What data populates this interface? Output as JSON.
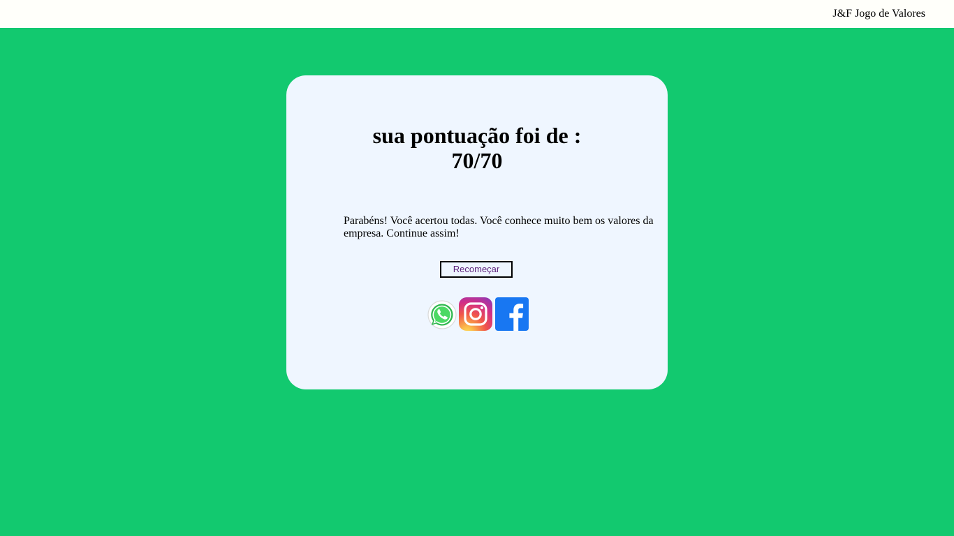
{
  "header": {
    "brand": "J&F Jogo de Valores"
  },
  "result": {
    "title_line1": "sua pontuação foi de :",
    "score": "70/70",
    "message": "Parabéns! Você acertou todas. Você conhece muito bem os valores da empresa. Continue assim!",
    "restart_label": "Recomeçar"
  },
  "social": {
    "icons": [
      "whatsapp-icon",
      "instagram-icon",
      "facebook-icon"
    ]
  },
  "colors": {
    "background": "#12c96f",
    "card": "#eff6ff",
    "topbar": "#fffffa",
    "button_text": "#5b1f7a"
  }
}
